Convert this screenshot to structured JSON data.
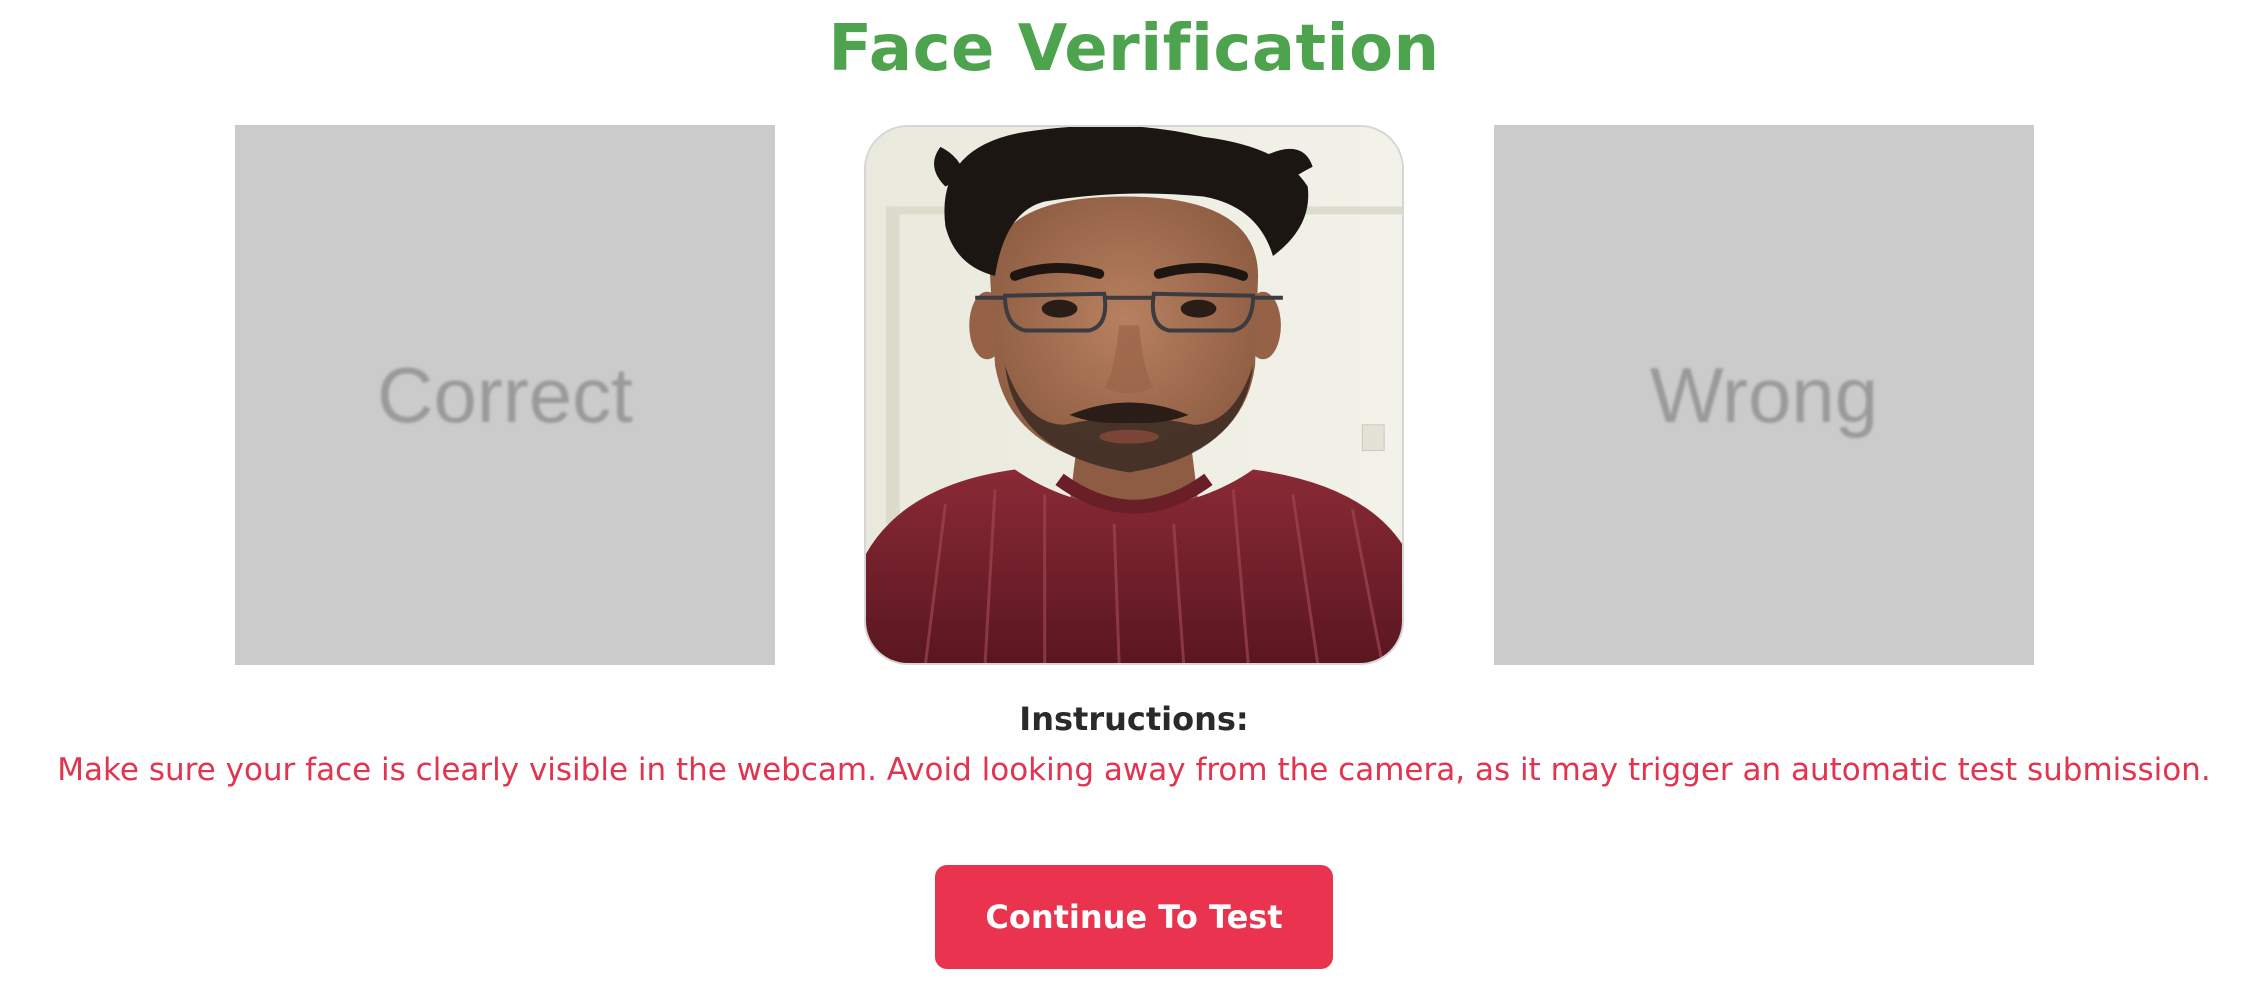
{
  "page": {
    "title": "Face Verification"
  },
  "samples": {
    "correct_label": "Correct",
    "wrong_label": "Wrong"
  },
  "webcam": {
    "feed": "live-webcam-feed"
  },
  "instructions": {
    "heading": "Instructions:",
    "text": "Make sure your face is clearly visible in the webcam. Avoid looking away from the camera, as it may trigger an automatic test submission."
  },
  "actions": {
    "continue_label": "Continue To Test"
  },
  "colors": {
    "title": "#4ea34f",
    "instruction_text": "#e2334f",
    "button_bg": "#ea344f",
    "sample_bg": "#cbcbcb"
  }
}
